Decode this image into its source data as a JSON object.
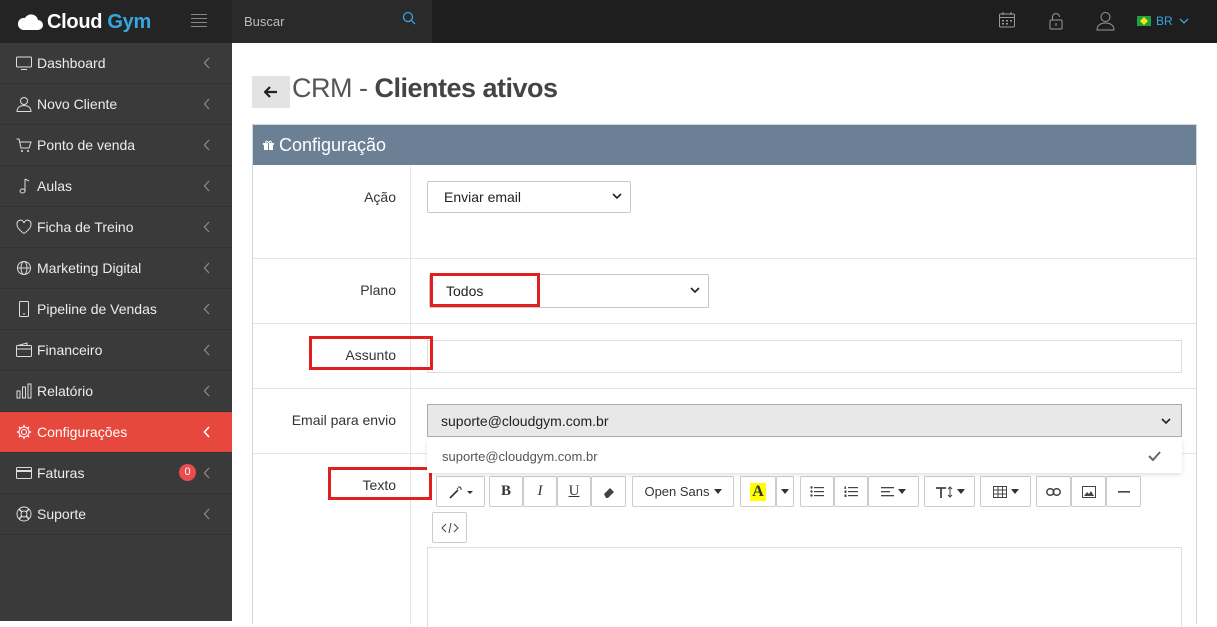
{
  "brand": {
    "name_part1": "Cloud ",
    "name_part2": "Gym"
  },
  "search": {
    "placeholder": "Buscar"
  },
  "top": {
    "lang": "BR"
  },
  "sidebar": {
    "items": [
      {
        "label": "Dashboard",
        "icon": "monitor-icon"
      },
      {
        "label": "Novo Cliente",
        "icon": "user-icon"
      },
      {
        "label": "Ponto de venda",
        "icon": "cart-icon"
      },
      {
        "label": "Aulas",
        "icon": "music-note-icon"
      },
      {
        "label": "Ficha de Treino",
        "icon": "heart-icon"
      },
      {
        "label": "Marketing Digital",
        "icon": "globe-icon"
      },
      {
        "label": "Pipeline de Vendas",
        "icon": "phone-icon"
      },
      {
        "label": "Financeiro",
        "icon": "wallet-icon"
      },
      {
        "label": "Relatório",
        "icon": "bar-chart-icon"
      },
      {
        "label": "Configurações",
        "icon": "gear-icon"
      },
      {
        "label": "Faturas",
        "icon": "credit-card-icon",
        "badge": "0"
      },
      {
        "label": "Suporte",
        "icon": "lifebuoy-icon"
      }
    ]
  },
  "page": {
    "title_prefix": "CRM - ",
    "title_main": "Clientes ativos"
  },
  "panel": {
    "title": "Configuração"
  },
  "form": {
    "acao_label": "Ação",
    "acao_value": "Enviar email",
    "plano_label": "Plano",
    "plano_value": "Todos",
    "assunto_label": "Assunto",
    "assunto_value": "",
    "email_label": "Email para envio",
    "email_value": "suporte@cloudgym.com.br",
    "email_option": "suporte@cloudgym.com.br",
    "texto_label": "Texto"
  },
  "editor": {
    "font_name": "Open Sans",
    "highlight_letter": "A"
  },
  "colors": {
    "accent": "#35a8e0",
    "active": "#e6483d",
    "panel_head": "#6b7f95",
    "highlight": "#e02020"
  }
}
